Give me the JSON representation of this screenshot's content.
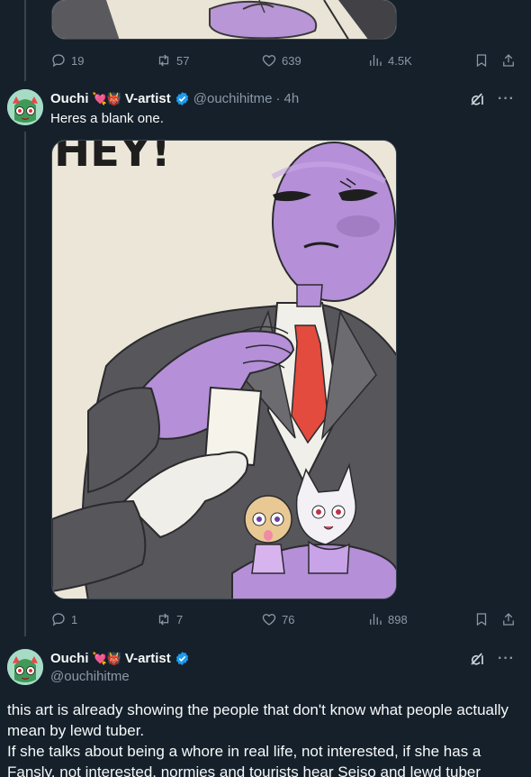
{
  "colors": {
    "bg": "#15202b",
    "muted": "#8b98a5",
    "text": "#f7f9f9",
    "verified": "#1d9bf0",
    "line": "#38444d"
  },
  "post1": {
    "stats": {
      "replies": "19",
      "reposts": "57",
      "likes": "639",
      "views": "4.5K"
    }
  },
  "post2": {
    "name": "Ouchi",
    "name_emoji": "💘👹",
    "name_suffix": "V-artist",
    "handle": "@ouchihitme",
    "separator": "·",
    "time": "4h",
    "text": "Heres a blank one.",
    "image_sign_text": "HEY!",
    "stats": {
      "replies": "1",
      "reposts": "7",
      "likes": "76",
      "views": "898"
    }
  },
  "post3": {
    "name": "Ouchi",
    "name_emoji": "💘👹",
    "name_suffix": "V-artist",
    "handle": "@ouchihitme",
    "text_lines": [
      "this art is already showing the people that don't know what people actually mean by lewd tuber.",
      "If she talks about being a whore in real life, not interested, if she has a Fansly, not interested, normies and tourists hear Seiso and lewd tuber"
    ]
  },
  "icons": {
    "reply": "reply-icon",
    "repost": "repost-icon",
    "like": "heart-icon",
    "views": "views-icon",
    "bookmark": "bookmark-icon",
    "share": "share-icon",
    "grok": "grok-icon",
    "more": "more-icon",
    "verified": "verified-badge-icon"
  }
}
